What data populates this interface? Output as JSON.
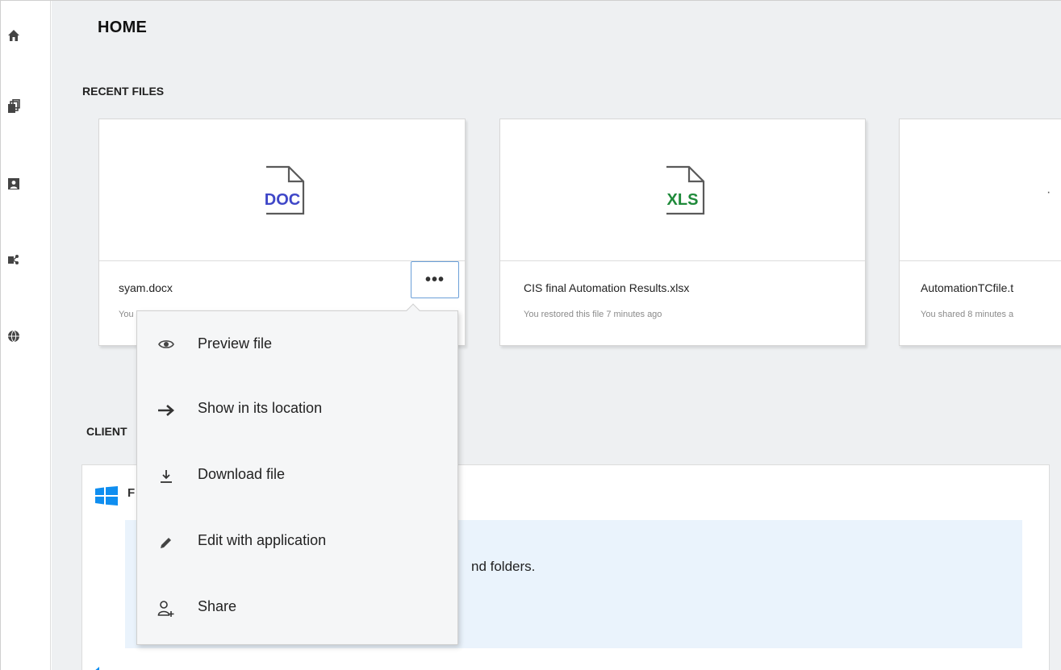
{
  "sidebar": {
    "items": [
      {
        "icon": "home-icon"
      },
      {
        "icon": "files-icon"
      },
      {
        "icon": "contacts-icon"
      },
      {
        "icon": "share-network-icon"
      },
      {
        "icon": "globe-icon"
      }
    ]
  },
  "header": {
    "title": "HOME"
  },
  "recent": {
    "title": "RECENT FILES",
    "files": [
      {
        "badge": "DOC",
        "badge_color": "#3f47c8",
        "name": "syam.docx",
        "status": "You opened this file"
      },
      {
        "badge": "XLS",
        "badge_color": "#1f8a3a",
        "name": "CIS final Automation Results.xlsx",
        "status": "You restored this file 7 minutes ago"
      },
      {
        "badge": "",
        "badge_color": "#555555",
        "name": "AutomationTCfile.t",
        "status": "You shared 8 minutes a"
      }
    ],
    "more_label": "•••"
  },
  "clients": {
    "title": "CLIENT",
    "first_letter": "F",
    "info_text": "nd folders."
  },
  "context_menu": {
    "items": [
      {
        "label": "Preview file",
        "icon": "eye-icon"
      },
      {
        "label": "Show in its location",
        "icon": "arrow-right-icon"
      },
      {
        "label": "Download file",
        "icon": "download-icon"
      },
      {
        "label": "Edit with application",
        "icon": "pencil-icon"
      },
      {
        "label": "Share",
        "icon": "add-user-icon"
      }
    ]
  }
}
